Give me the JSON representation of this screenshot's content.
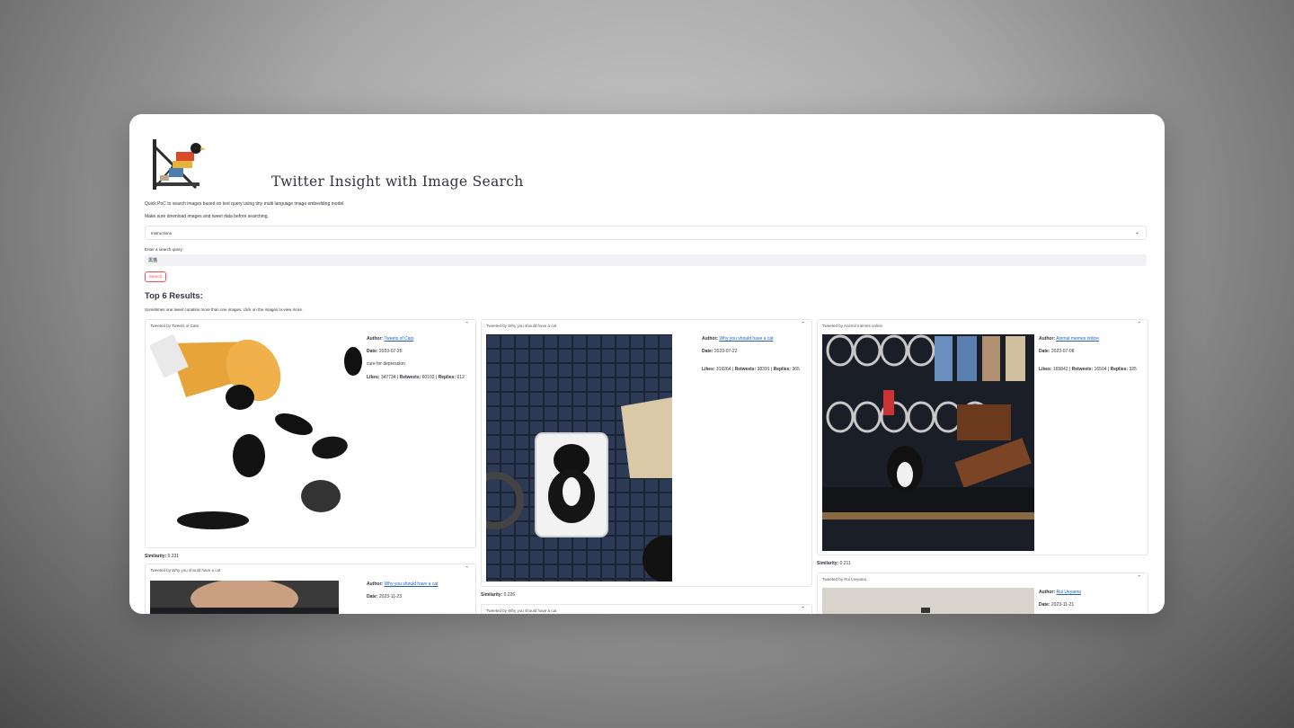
{
  "app": {
    "title": "Twitter Insight with Image Search",
    "caption1": "Quick PoC to search images based on text query using tiny multi language image embedding model.",
    "caption2": "Make sure download images and tweet data before searching."
  },
  "instructions": {
    "label": "Instructions"
  },
  "search": {
    "label": "Enter a search query:",
    "value": "黒猫",
    "button": "Search"
  },
  "results": {
    "heading": "Top 6 Results:",
    "note": "Sometimes one tweet conatins more than one images, click on the images to view more.",
    "cards": [
      {
        "header": "Tweeted by Tweets of Cats",
        "author_label": "Author:",
        "author": "Tweets of Cats",
        "date_label": "Date:",
        "date": "2023-07-25",
        "text": "cure for depression",
        "likes_label": "Likes:",
        "likes": "347734",
        "retweets_label": "Retweets:",
        "retweets": "60102",
        "replies_label": "Replies:",
        "replies": "612",
        "similarity_label": "Similarity:",
        "similarity": "0.231"
      },
      {
        "header": "Tweeted by Why you should have a cat",
        "author_label": "Author:",
        "author": "Why you should have a cat",
        "date_label": "Date:",
        "date": "2023-07-22",
        "likes_label": "Likes:",
        "likes": "319264",
        "retweets_label": "Retweets:",
        "retweets": "38391",
        "replies_label": "Replies:",
        "replies": "365",
        "similarity_label": "Similarity:",
        "similarity": "0.226"
      },
      {
        "header": "Tweeted by Animal memes online",
        "author_label": "Author:",
        "author": "Animal memes online",
        "date_label": "Date:",
        "date": "2023-07-08",
        "likes_label": "Likes:",
        "likes": "165842",
        "retweets_label": "Retweets:",
        "retweets": "16504",
        "replies_label": "Replies:",
        "replies": "325",
        "similarity_label": "Similarity:",
        "similarity": "0.211"
      },
      {
        "header": "Tweeted by Why you should have a cat",
        "author_label": "Author:",
        "author": "Why you should have a cat",
        "date_label": "Date:",
        "date": "2023-11-23"
      },
      {
        "header": "Tweeted by Why you should have a cat"
      },
      {
        "header": "Tweeted by Rui Ueyama",
        "author_label": "Author:",
        "author": "Rui Ueyama",
        "date_label": "Date:",
        "date": "2023-11-21"
      }
    ]
  },
  "icons": {
    "expand": "chevron-down-icon",
    "collapse": "chevron-up-icon"
  },
  "colors": {
    "primary": "#ff4b4b",
    "link": "#1f5fc2",
    "text": "#31333f"
  }
}
